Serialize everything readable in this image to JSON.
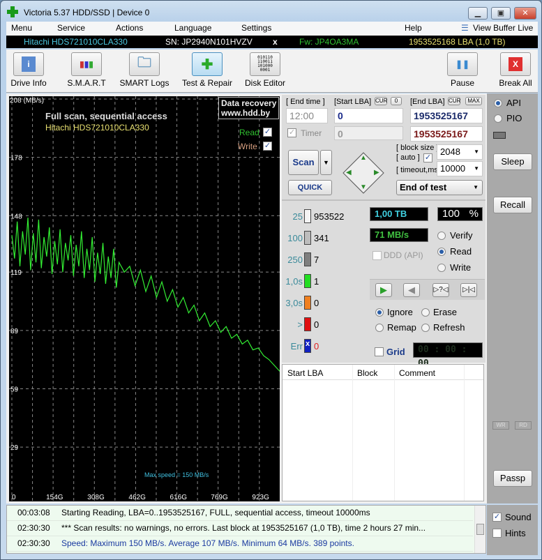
{
  "window": {
    "title": "Victoria 5.37 HDD/SSD | Device 0",
    "minimize": "▁",
    "maximize": "▣",
    "close": "✕"
  },
  "menu": {
    "items": [
      "Menu",
      "Service",
      "Actions",
      "Language",
      "Settings",
      "Help"
    ],
    "view_buffer": "View Buffer Live"
  },
  "drive": {
    "model": "Hitachi HDS721010CLA330",
    "serial": "SN: JP2940N101HVZV",
    "close": "x",
    "firmware": "Fw: JP4OA3MA",
    "capacity": "1953525168 LBA (1,0 TB)"
  },
  "toolbar": {
    "drive_info": "Drive Info",
    "smart": "S.M.A.R.T",
    "smart_logs": "SMART Logs",
    "test_repair": "Test & Repair",
    "disk_editor": "Disk Editor",
    "pause": "Pause",
    "break_all": "Break All",
    "disk_editor_glyph": "010110\n110011\n101000\n0001"
  },
  "chart": {
    "title": "Full scan, sequential access",
    "subtitle": "Hitachi HDS721010CLA330",
    "badge_line1": "Data recovery",
    "badge_line2": "www.hdd.by",
    "read_label": "Read",
    "write_label": "Write",
    "read_checked": true,
    "write_checked": true,
    "max_speed_note": "Max speed = 150 MB/s",
    "line_color": "#33ee33"
  },
  "chart_data": {
    "type": "line",
    "yunit": "(MB/s)",
    "ylim": [
      0,
      208
    ],
    "yticks": [
      "208",
      "178",
      "148",
      "119",
      "89",
      "59",
      "29"
    ],
    "ytick_values": [
      208,
      178,
      148,
      119,
      89,
      59,
      29
    ],
    "xticks": [
      "0",
      "154G",
      "308G",
      "462G",
      "616G",
      "769G",
      "923G"
    ],
    "xtick_values": [
      0,
      154,
      308,
      462,
      616,
      769,
      923
    ],
    "xlim": [
      0,
      1000
    ],
    "grid": true,
    "series": [
      {
        "values_x": [
          0,
          10,
          20,
          30,
          40,
          50,
          60,
          70,
          80,
          90,
          100,
          110,
          120,
          130,
          140,
          150,
          160,
          170,
          180,
          190,
          200,
          210,
          220,
          230,
          240,
          250,
          260,
          270,
          280,
          290,
          300,
          310,
          320,
          330,
          340,
          350,
          360,
          370,
          380,
          390,
          400,
          420,
          440,
          460,
          480,
          500,
          520,
          540,
          560,
          580,
          600,
          620,
          640,
          660,
          680,
          700,
          720,
          740,
          760,
          780,
          800,
          820,
          840,
          860,
          880,
          900,
          920,
          940,
          960,
          980,
          1000
        ],
        "values_y": [
          138,
          126,
          145,
          122,
          140,
          128,
          147,
          120,
          139,
          124,
          146,
          121,
          137,
          127,
          142,
          118,
          135,
          123,
          141,
          119,
          134,
          125,
          138,
          117,
          133,
          122,
          140,
          116,
          131,
          120,
          137,
          114,
          129,
          118,
          134,
          113,
          127,
          116,
          131,
          111,
          124,
          119,
          122,
          112,
          120,
          109,
          117,
          106,
          114,
          104,
          110,
          101,
          106,
          98,
          102,
          94,
          98,
          91,
          94,
          88,
          91,
          85,
          87,
          82,
          84,
          79,
          80,
          76,
          74,
          71,
          68
        ]
      }
    ]
  },
  "controls": {
    "end_time_label": "[ End time ]",
    "end_time": "12:00",
    "start_lba_label": "[Start LBA]",
    "cur": "CUR",
    "zero": "0",
    "end_lba_label": "[End LBA]",
    "max": "MAX",
    "start_lba": "0",
    "end_lba": "1953525167",
    "timer_label": "Timer",
    "timer_value": "0",
    "end_lba2": "1953525167",
    "scan": "Scan",
    "quick": "QUICK",
    "block_size_label": "[ block size ]",
    "auto_label": "[ auto ]",
    "timeout_label": "[ timeout,ms ]",
    "block_size": "2048",
    "timeout": "10000",
    "end_action": "End of test"
  },
  "stats": {
    "blocks": [
      {
        "label": "25",
        "count": "953522",
        "color": "#f4f4f4"
      },
      {
        "label": "100",
        "count": "341",
        "color": "#bdbdbd"
      },
      {
        "label": "250",
        "count": "7",
        "color": "#7f7f7f"
      },
      {
        "label": "1,0s",
        "count": "1",
        "color": "#22dd22"
      },
      {
        "label": "3,0s",
        "count": "0",
        "color": "#f08020"
      },
      {
        "label": ">",
        "count": "0",
        "color": "#e01010"
      },
      {
        "label": "Err",
        "count": "0",
        "color": "#1020c0"
      }
    ],
    "size": "1,00 TB",
    "percent": "100",
    "percent_sign": "%",
    "progress_percent": 100,
    "speed": "71 MB/s",
    "ddd": "DDD (API)",
    "verify": "Verify",
    "read": "Read",
    "write": "Write",
    "mode": "Read",
    "ignore": "Ignore",
    "erase": "Erase",
    "remap": "Remap",
    "refresh": "Refresh",
    "action": "Ignore",
    "grid": "Grid",
    "timer": "00 : 00 : 00",
    "play_glyph": "▶",
    "back_glyph": "◀",
    "seek_glyph": "▷?◁",
    "end_glyph": "▷|◁"
  },
  "table": {
    "columns": [
      "Start LBA",
      "Block",
      "Comment"
    ]
  },
  "side": {
    "api": "API",
    "pio": "PIO",
    "sleep": "Sleep",
    "recall": "Recall",
    "wr": "WR",
    "rd": "RD",
    "passp": "Passp",
    "sound": "Sound",
    "hints": "Hints"
  },
  "log": [
    {
      "time": "00:03:08",
      "msg": "Starting Reading, LBA=0..1953525167, FULL, sequential access, timeout 10000ms",
      "color": "#000000"
    },
    {
      "time": "02:30:30",
      "msg": "*** Scan results: no warnings, no errors. Last block at 1953525167 (1,0 TB), time 2 hours 27 min...",
      "color": "#000000"
    },
    {
      "time": "02:30:30",
      "msg": "Speed: Maximum 150 MB/s. Average 107 MB/s. Minimum 64 MB/s. 389 points.",
      "color": "#1a3aa0"
    }
  ]
}
